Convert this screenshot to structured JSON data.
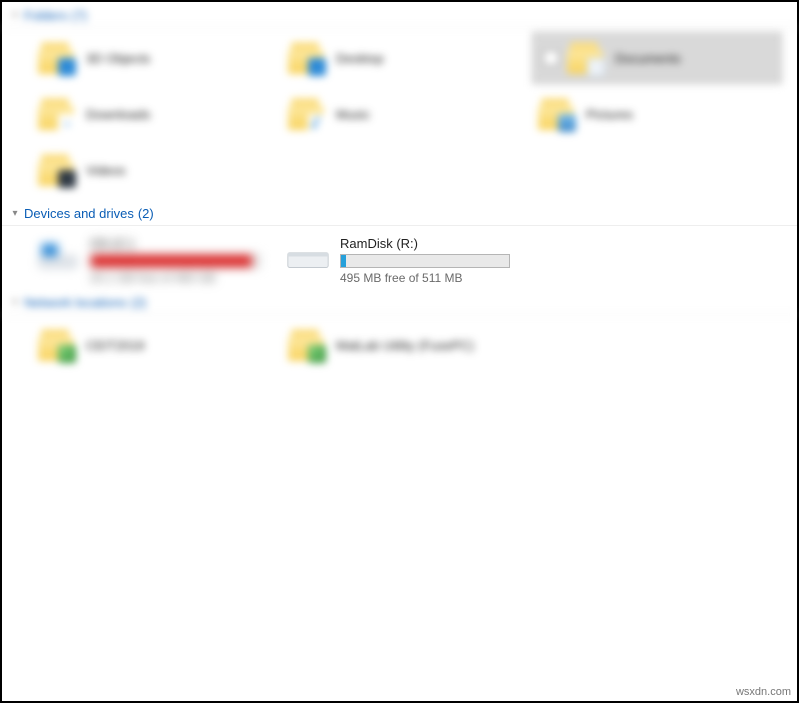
{
  "sections": {
    "folders": {
      "title": "Folders",
      "count": "(7)",
      "items": [
        {
          "label": "3D Objects"
        },
        {
          "label": "Downloads"
        },
        {
          "label": "Videos"
        },
        {
          "label": "Desktop"
        },
        {
          "label": "Music"
        },
        {
          "label": "Documents",
          "selected": true
        },
        {
          "label": "Pictures"
        }
      ]
    },
    "drives": {
      "title": "Devices and drives",
      "count": "(2)",
      "items": [
        {
          "name": "OS (C:)",
          "free_text": "20.1 GB free of 465 GB",
          "fill_color": "#d22",
          "fill_percent": 96
        },
        {
          "name": "RamDisk (R:)",
          "free_text": "495 MB free of 511 MB",
          "fill_color": "#26a0da",
          "fill_percent": 3
        }
      ]
    },
    "network": {
      "title": "Network locations",
      "count": "(2)",
      "items": [
        {
          "label": "CEIT2019"
        },
        {
          "label": "MatLab Utility (FusePC)"
        }
      ]
    }
  },
  "watermark": "wsxdn.com"
}
